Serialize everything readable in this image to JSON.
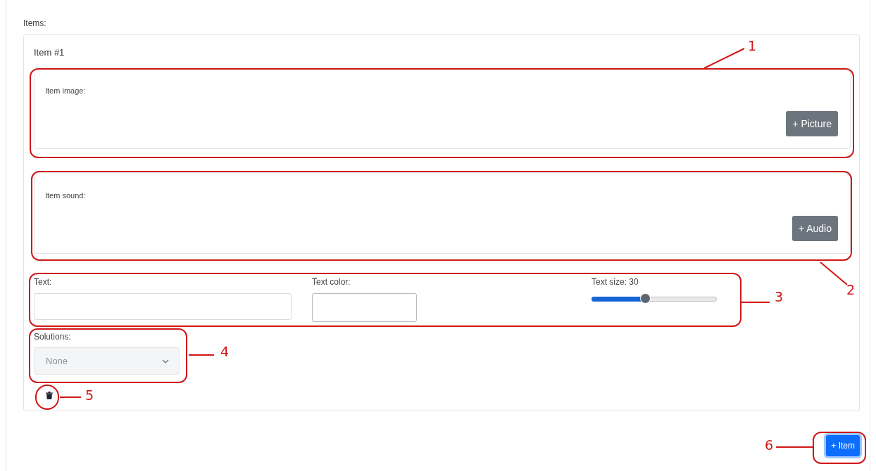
{
  "items_label": "Items:",
  "item": {
    "title": "Item #1",
    "image_panel": {
      "label": "Item image:",
      "button": "+ Picture"
    },
    "sound_panel": {
      "label": "Item sound:",
      "button": "+ Audio"
    },
    "text_field": {
      "label": "Text:"
    },
    "color_field": {
      "label": "Text color:"
    },
    "size_slider": {
      "label": "Text size: 30",
      "level": 0.43
    },
    "solutions": {
      "label": "Solutions:",
      "value": "None",
      "disabled": true
    }
  },
  "add_button": "+ Item",
  "annotations": [
    {
      "number": "1"
    },
    {
      "number": "2"
    },
    {
      "number": "3"
    },
    {
      "number": "4"
    },
    {
      "number": "5"
    },
    {
      "number": "6"
    }
  ]
}
